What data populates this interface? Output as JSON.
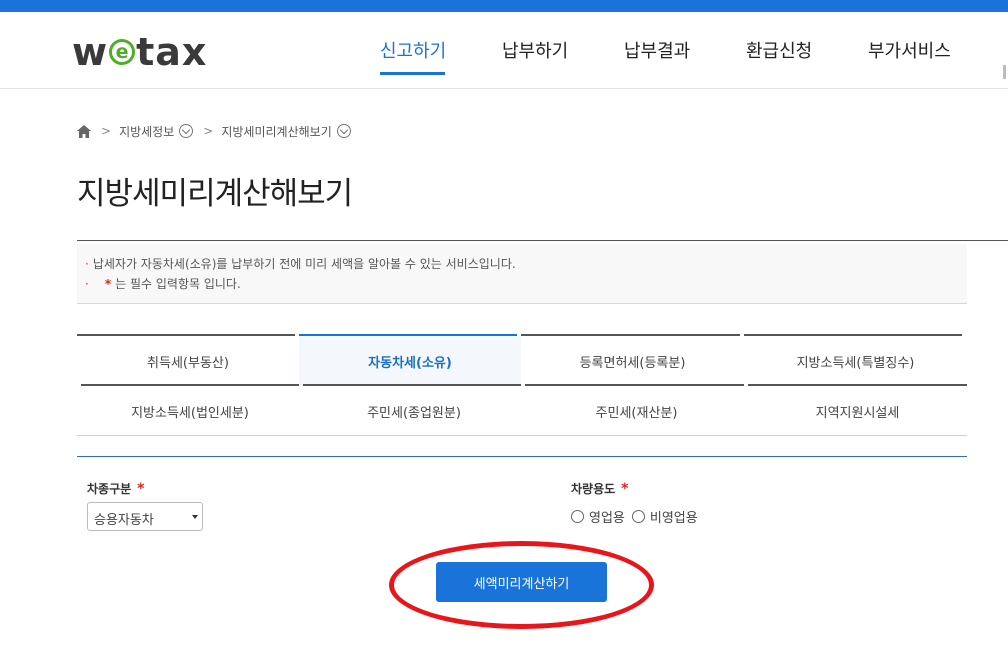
{
  "brand": {
    "logo_pre": "w",
    "logo_e": "e",
    "logo_post": "tax"
  },
  "nav": {
    "items": [
      {
        "label": "신고하기",
        "active": true
      },
      {
        "label": "납부하기",
        "active": false
      },
      {
        "label": "납부결과",
        "active": false
      },
      {
        "label": "환급신청",
        "active": false
      },
      {
        "label": "부가서비스",
        "active": false
      }
    ]
  },
  "breadcrumb": {
    "level1": "지방세정보",
    "level2": "지방세미리계산해보기"
  },
  "page": {
    "title": "지방세미리계산해보기"
  },
  "notice": {
    "line1": "납세자가 자동차세(소유)를 납부하기 전에 미리 세액을 알아볼 수 있는 서비스입니다.",
    "line2_star": "*",
    "line2": "는 필수 입력항목 입니다."
  },
  "tabs": [
    {
      "label": "취득세(부동산)",
      "active": false
    },
    {
      "label": "자동차세(소유)",
      "active": true
    },
    {
      "label": "등록면허세(등록분)",
      "active": false
    },
    {
      "label": "지방소득세(특별징수)",
      "active": false
    },
    {
      "label": "지방소득세(법인세분)",
      "active": false
    },
    {
      "label": "주민세(종업원분)",
      "active": false
    },
    {
      "label": "주민세(재산분)",
      "active": false
    },
    {
      "label": "지역지원시설세",
      "active": false
    }
  ],
  "form": {
    "vehicle_type": {
      "label": "차종구분",
      "required": "*",
      "value": "승용자동차"
    },
    "vehicle_use": {
      "label": "차량용도",
      "required": "*",
      "options": [
        "영업용",
        "비영업용"
      ]
    },
    "calc_button": "세액미리계산하기"
  },
  "colors": {
    "accent": "#1a73d9",
    "annotation": "#e8161b",
    "required": "#e02020"
  }
}
